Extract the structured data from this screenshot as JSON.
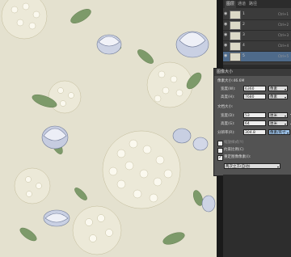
{
  "panel": {
    "tabs": [
      "图层",
      "通道",
      "路径"
    ],
    "layers": [
      {
        "name": "1",
        "shortcut": "Ctrl+1"
      },
      {
        "name": "2",
        "shortcut": "Ctrl+2"
      },
      {
        "name": "3",
        "shortcut": "Ctrl+3"
      },
      {
        "name": "4",
        "shortcut": "Ctrl+4"
      },
      {
        "name": "5",
        "shortcut": "Ctrl+5"
      }
    ]
  },
  "dialog": {
    "title": "图像大小",
    "pixel_size": "像素大小:46.6M",
    "width_label": "宽度(W):",
    "width_value": "6360",
    "width_unit": "像素",
    "height_label": "高度(H):",
    "height_value": "7680",
    "height_unit": "像素",
    "doc_size": "文档大小:",
    "doc_width_label": "宽度(D):",
    "doc_width_value": "53",
    "doc_width_unit": "厘米",
    "doc_height_label": "高度(G):",
    "doc_height_value": "64",
    "doc_height_unit": "厘米",
    "res_label": "分辨率(R):",
    "res_value": "304.8",
    "res_unit": "像素/英寸",
    "scale_styles": "缩放样式(Y)",
    "constrain": "约束比例(C)",
    "resample": "重定图像像素(I):",
    "resample_method": "两次立方(自动)"
  },
  "colors": {
    "canvas_bg": "#e4e1cf",
    "panel_bg": "#3b3b3b",
    "selected_layer": "#4e6a8a",
    "dialog_bg": "#535353"
  }
}
